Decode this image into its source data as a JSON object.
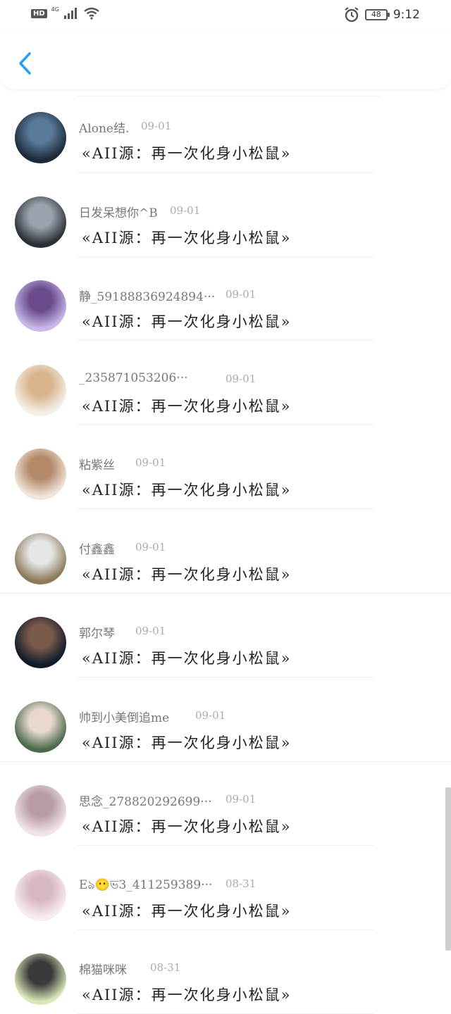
{
  "status_bar": {
    "hd": "HD",
    "network": "4G",
    "battery": "48",
    "time": "9:12",
    "icons": [
      "signal-icon",
      "wifi-icon",
      "alarm-icon",
      "battery-icon"
    ]
  },
  "nav": {
    "back_icon": "chevron-left-icon",
    "accent": "#2a9df4"
  },
  "items": [
    {
      "name": "Alone结.",
      "date": "09-01",
      "message": "«AII源：再一次化身小松鼠»",
      "avatar_colors": [
        "#1c2a3a",
        "#5a7a9a"
      ]
    },
    {
      "name": "日发呆想你^B",
      "date": "09-01",
      "message": "«AII源：再一次化身小松鼠»",
      "avatar_colors": [
        "#2b2f36",
        "#9aa3ad"
      ]
    },
    {
      "name": "静_59188836924894···",
      "date": "09-01",
      "message": "«AII源：再一次化身小松鼠»",
      "avatar_colors": [
        "#c9b8e8",
        "#6a4c8c"
      ]
    },
    {
      "name": "_235871053206···",
      "date": "09-01",
      "message": "«AII源：再一次化身小松鼠»",
      "avatar_colors": [
        "#f4efe8",
        "#d9b48c"
      ]
    },
    {
      "name": "粘紫丝",
      "date": "09-01",
      "message": "«AII源：再一次化身小松鼠»",
      "avatar_colors": [
        "#f1e6dc",
        "#b48a6a"
      ]
    },
    {
      "name": "付鑫鑫",
      "date": "09-01",
      "message": "«AII源：再一次化身小松鼠»",
      "avatar_colors": [
        "#8c7a5a",
        "#e6e6e6"
      ]
    },
    {
      "name": "郭尔琴",
      "date": "09-01",
      "message": "«AII源：再一次化身小松鼠»",
      "avatar_colors": [
        "#0e1a2a",
        "#7a5a4a"
      ]
    },
    {
      "name": "帅到小美倒追me",
      "date": "09-01",
      "message": "«AII源：再一次化身小松鼠»",
      "avatar_colors": [
        "#4a6a4a",
        "#e8d8d0"
      ]
    },
    {
      "name": "思念_278820292699···",
      "date": "09-01",
      "message": "«AII源：再一次化身小松鼠»",
      "avatar_colors": [
        "#f0e4e8",
        "#b89aa8"
      ]
    },
    {
      "name": "Eঌ😶ভ3_411259389···",
      "date": "08-31",
      "message": "«AII源：再一次化身小松鼠»",
      "avatar_colors": [
        "#f8eef0",
        "#d8b8c0"
      ]
    },
    {
      "name": "棉猫咪咪",
      "date": "08-31",
      "message": "«AII源：再一次化身小松鼠»",
      "avatar_colors": [
        "#d8e8b8",
        "#3a3a3a"
      ]
    }
  ]
}
